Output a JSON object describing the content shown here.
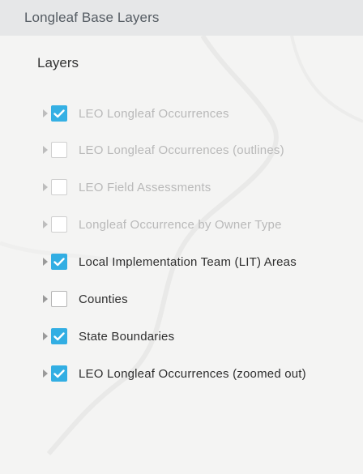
{
  "panel": {
    "title": "Longleaf Base Layers",
    "section_title": "Layers"
  },
  "colors": {
    "checkbox_checked": "#32aee3",
    "header_bg": "#e6e7e8",
    "disabled_text": "#b9b9b9"
  },
  "layers": [
    {
      "label": "LEO Longleaf Occurrences",
      "checked": true,
      "disabled": true
    },
    {
      "label": "LEO Longleaf Occurrences (outlines)",
      "checked": false,
      "disabled": true
    },
    {
      "label": "LEO Field Assessments",
      "checked": false,
      "disabled": true
    },
    {
      "label": "Longleaf Occurrence by Owner Type",
      "checked": false,
      "disabled": true
    },
    {
      "label": "Local Implementation Team (LIT) Areas",
      "checked": true,
      "disabled": false
    },
    {
      "label": "Counties",
      "checked": false,
      "disabled": false
    },
    {
      "label": "State Boundaries",
      "checked": true,
      "disabled": false
    },
    {
      "label": "LEO Longleaf Occurrences (zoomed out)",
      "checked": true,
      "disabled": false
    }
  ]
}
